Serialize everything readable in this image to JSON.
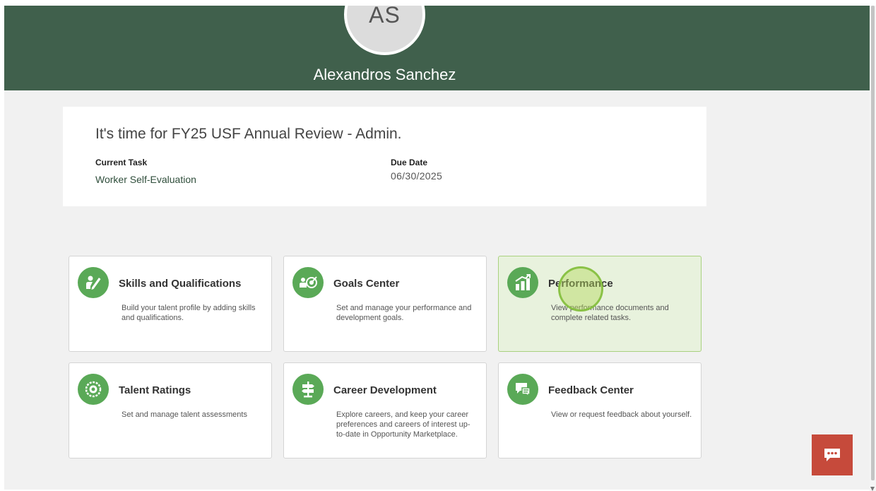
{
  "profile": {
    "initials": "AS",
    "name": "Alexandros Sanchez"
  },
  "review": {
    "title": "It's time for FY25 USF Annual Review - Admin.",
    "current_task_label": "Current Task",
    "current_task_value": "Worker Self-Evaluation",
    "due_date_label": "Due Date",
    "due_date_value": "06/30/2025"
  },
  "tiles": [
    {
      "title": "Skills and Qualifications",
      "description": "Build your talent profile by adding skills and qualifications.",
      "icon": "skills-icon"
    },
    {
      "title": "Goals Center",
      "description": "Set and manage your performance and development goals.",
      "icon": "goals-icon"
    },
    {
      "title": "Performance",
      "description": "View performance documents and complete related tasks.",
      "icon": "performance-icon"
    },
    {
      "title": "Talent Ratings",
      "description": "Set and manage talent assessments",
      "icon": "talent-ratings-icon"
    },
    {
      "title": "Career Development",
      "description": "Explore careers, and keep your career preferences and careers of interest up-to-date in Opportunity Marketplace.",
      "icon": "career-signpost-icon"
    },
    {
      "title": "Feedback Center",
      "description": "View or request feedback about yourself.",
      "icon": "feedback-icon"
    }
  ],
  "colors": {
    "header": "#40604c",
    "tile_icon": "#5aa957",
    "active_tile": "#e8f2dd",
    "chat_button": "#c64a3b"
  },
  "chat": {
    "icon": "chat-bubble-icon"
  }
}
